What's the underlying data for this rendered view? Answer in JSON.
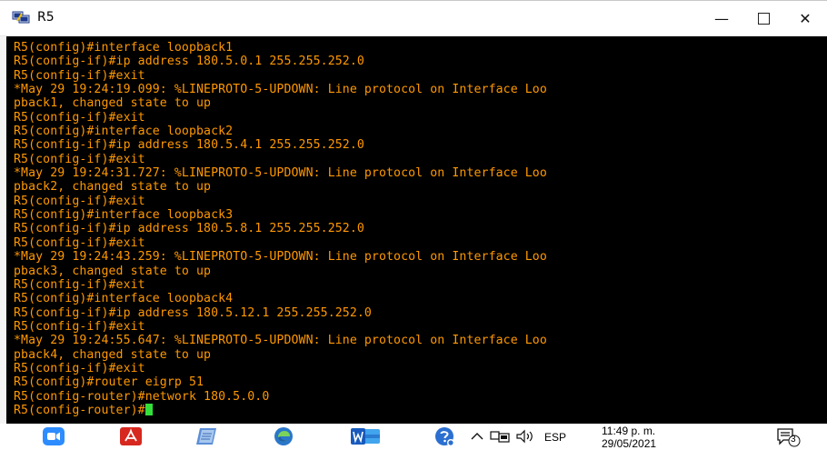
{
  "window": {
    "title": "R5",
    "minimize_glyph": "—",
    "close_glyph": "✕"
  },
  "terminal": {
    "lines": [
      "R5(config)#interface loopback1",
      "R5(config-if)#ip address 180.5.0.1 255.255.252.0",
      "R5(config-if)#exit",
      "*May 29 19:24:19.099: %LINEPROTO-5-UPDOWN: Line protocol on Interface Loo",
      "pback1, changed state to up",
      "R5(config-if)#exit",
      "R5(config)#interface loopback2",
      "R5(config-if)#ip address 180.5.4.1 255.255.252.0",
      "R5(config-if)#exit",
      "*May 29 19:24:31.727: %LINEPROTO-5-UPDOWN: Line protocol on Interface Loo",
      "pback2, changed state to up",
      "R5(config-if)#exit",
      "R5(config)#interface loopback3",
      "R5(config-if)#ip address 180.5.8.1 255.255.252.0",
      "R5(config-if)#exit",
      "*May 29 19:24:43.259: %LINEPROTO-5-UPDOWN: Line protocol on Interface Loo",
      "pback3, changed state to up",
      "R5(config-if)#exit",
      "R5(config)#interface loopback4",
      "R5(config-if)#ip address 180.5.12.1 255.255.252.0",
      "R5(config-if)#exit",
      "*May 29 19:24:55.647: %LINEPROTO-5-UPDOWN: Line protocol on Interface Loo",
      "pback4, changed state to up",
      "R5(config-if)#exit",
      "R5(config)#router eigrp 51",
      "R5(config-router)#network 180.5.0.0"
    ],
    "prompt": "R5(config-router)#",
    "text_color": "#ff9800",
    "cursor_color": "#33e03a",
    "background": "#000000"
  },
  "taskbar": {
    "apps": [
      {
        "name": "zoom-icon",
        "color": "#2d8cff"
      },
      {
        "name": "acrobat-icon",
        "color": "#d7281f"
      },
      {
        "name": "notepad-icon",
        "color": "#3a7bd5"
      },
      {
        "name": "edge-icon",
        "color": "#2a77c9"
      },
      {
        "name": "word-icon",
        "color": "#2b579a"
      }
    ],
    "tray": {
      "language": "ESP",
      "time": "11:49 p. m.",
      "date": "29/05/2021",
      "notification_count": "3"
    }
  }
}
